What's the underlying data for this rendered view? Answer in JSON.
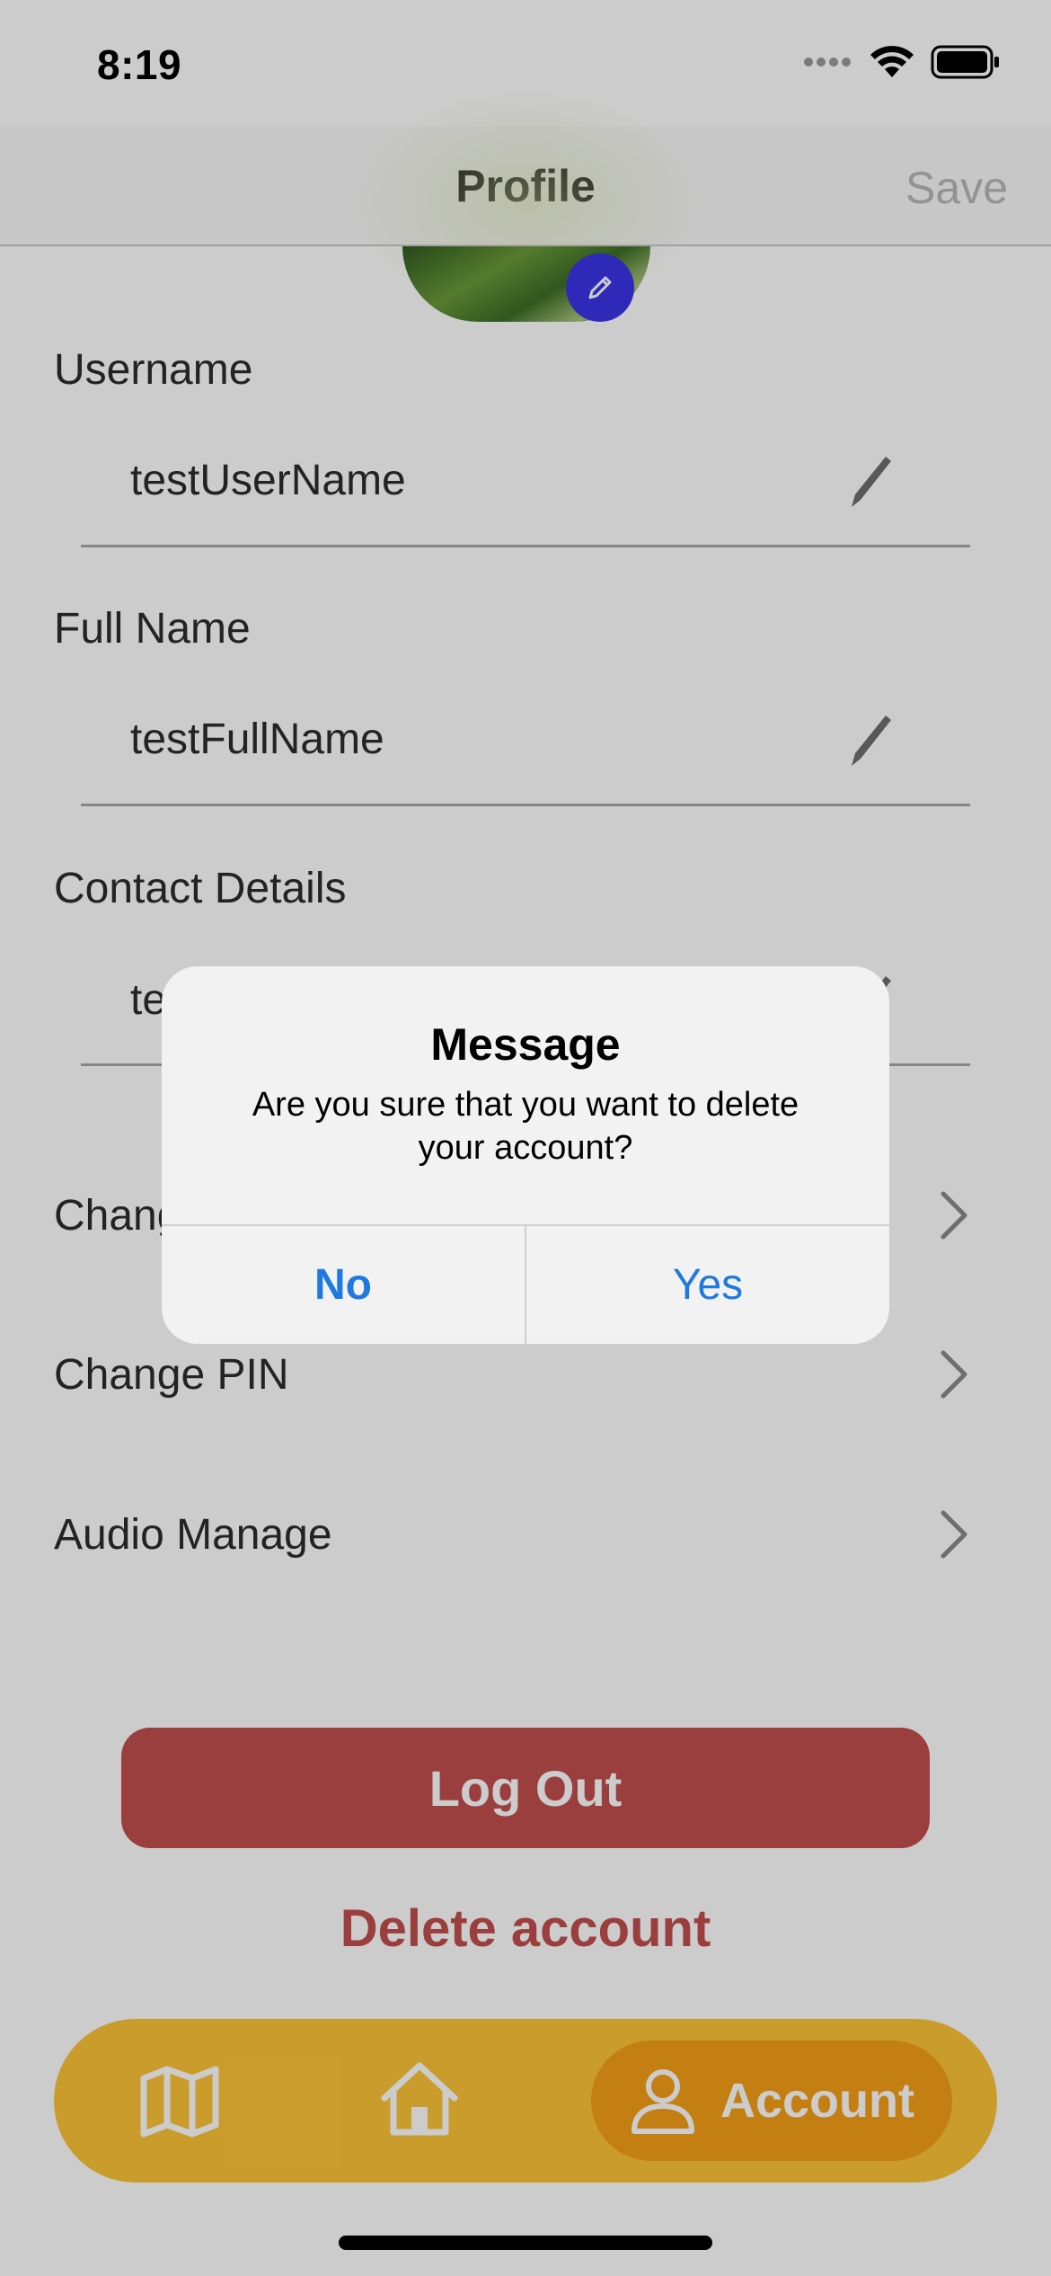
{
  "status_bar": {
    "time": "8:19"
  },
  "nav": {
    "title": "Profile",
    "save_label": "Save"
  },
  "form": {
    "username": {
      "label": "Username",
      "value": "testUserName"
    },
    "full_name": {
      "label": "Full Name",
      "value": "testFullName"
    },
    "contact": {
      "label": "Contact Details",
      "value": "te"
    }
  },
  "menu": {
    "change_partial": "Chang",
    "change_pin": "Change PIN",
    "audio_manage": "Audio Manage"
  },
  "actions": {
    "logout_label": "Log Out",
    "delete_label": "Delete account"
  },
  "tab_bar": {
    "items": [
      {
        "icon": "map-icon"
      },
      {
        "icon": "home-icon"
      },
      {
        "icon": "person-icon",
        "label": "Account",
        "selected": true
      }
    ]
  },
  "alert": {
    "title": "Message",
    "message": "Are you sure that you want to delete your account?",
    "no_label": "No",
    "yes_label": "Yes"
  },
  "colors": {
    "accent_red": "#c24e4e",
    "tab_bar": "#fdc438",
    "tab_selected": "#f59f18",
    "alert_button": "#1f7ae0",
    "avatar_edit": "#3b34e8"
  }
}
